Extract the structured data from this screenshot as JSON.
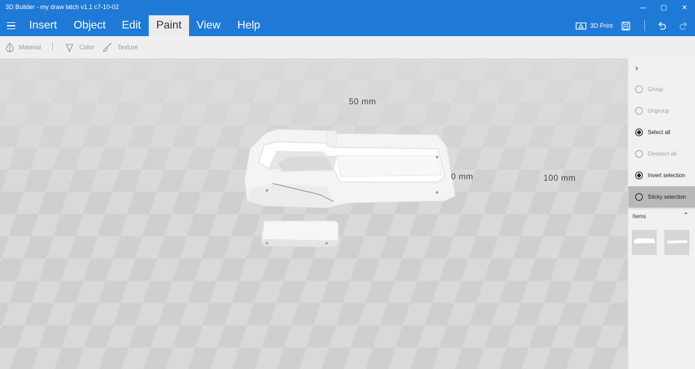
{
  "window": {
    "title": "3D Builder - my draw latch v1.1 c7-10-02",
    "controls": {
      "minimize": "—",
      "maximize": "▢",
      "close": "✕"
    }
  },
  "menu": {
    "hamburger_icon": "hamburger-icon",
    "items": [
      "Insert",
      "Object",
      "Edit",
      "Paint",
      "View",
      "Help"
    ],
    "active": "Paint",
    "print_label": "3D Print"
  },
  "paint_toolbar": {
    "material": "Material",
    "color": "Color",
    "texture": "Texture"
  },
  "viewport": {
    "labels": {
      "top": "50 mm",
      "middle": "0 mm",
      "right": "100 mm"
    }
  },
  "panel": {
    "buttons": [
      {
        "label": "Group",
        "state": "disabled"
      },
      {
        "label": "Ungroup",
        "state": "disabled"
      },
      {
        "label": "Select all",
        "state": "enabled"
      },
      {
        "label": "Deselect all",
        "state": "disabled"
      },
      {
        "label": "Invert selection",
        "state": "enabled"
      },
      {
        "label": "Sticky selection",
        "state": "active"
      }
    ],
    "items_header": "Items"
  },
  "colors": {
    "accent": "#1e7ad6",
    "viewport_light": "#d9d9d9",
    "viewport_dark": "#cccccc",
    "active_button": "#b8b8b8"
  }
}
